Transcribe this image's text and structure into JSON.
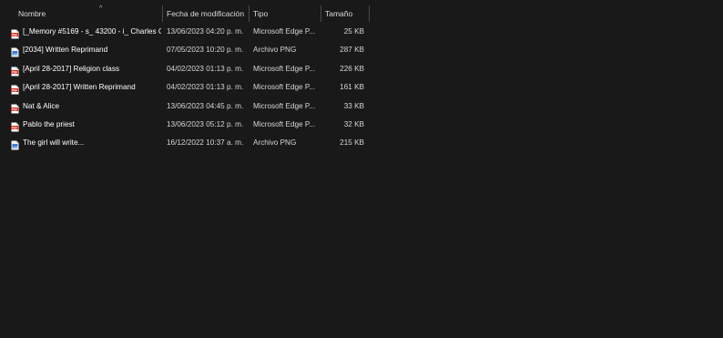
{
  "columns": {
    "name": "Nombre",
    "date": "Fecha de modificación",
    "type": "Tipo",
    "size": "Tamaño"
  },
  "sort_indicator": "^",
  "files": [
    {
      "name": "[_Memory #5169 - s_ 43200 - i_ Charles C...",
      "date": "13/06/2023 04:20 p. m.",
      "type": "Microsoft Edge P...",
      "size": "25 KB",
      "icon": "pdf-file-icon"
    },
    {
      "name": "[2034] Written Reprimand",
      "date": "07/05/2023 10:20 p. m.",
      "type": "Archivo PNG",
      "size": "287 KB",
      "icon": "png-file-icon"
    },
    {
      "name": "[April 28-2017] Religion class",
      "date": "04/02/2023 01:13 p. m.",
      "type": "Microsoft Edge P...",
      "size": "226 KB",
      "icon": "pdf-file-icon"
    },
    {
      "name": "[April 28-2017] Written Reprimand",
      "date": "04/02/2023 01:13 p. m.",
      "type": "Microsoft Edge P...",
      "size": "161 KB",
      "icon": "pdf-file-icon"
    },
    {
      "name": "Nat & Alice",
      "date": "13/06/2023 04:45 p. m.",
      "type": "Microsoft Edge P...",
      "size": "33 KB",
      "icon": "pdf-file-icon"
    },
    {
      "name": "Pablo the priest",
      "date": "13/06/2023 05:12 p. m.",
      "type": "Microsoft Edge P...",
      "size": "32 KB",
      "icon": "pdf-file-icon"
    },
    {
      "name": "The girl will write...",
      "date": "16/12/2022 10:37 a. m.",
      "type": "Archivo PNG",
      "size": "215 KB",
      "icon": "png-file-icon"
    }
  ],
  "colors": {
    "background": "#191919",
    "pdf_icon": "#d9261c",
    "png_icon": "#3a7bd5"
  }
}
